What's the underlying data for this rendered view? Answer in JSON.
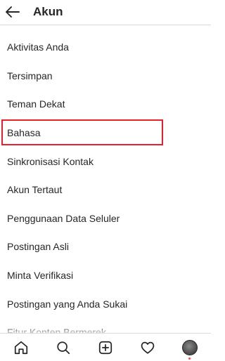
{
  "header": {
    "title": "Akun",
    "back_icon": "arrow-left-icon"
  },
  "menu": {
    "items": [
      {
        "label": "Aktivitas Anda"
      },
      {
        "label": "Tersimpan"
      },
      {
        "label": "Teman Dekat"
      },
      {
        "label": "Bahasa",
        "highlighted": true
      },
      {
        "label": "Sinkronisasi Kontak"
      },
      {
        "label": "Akun Tertaut"
      },
      {
        "label": "Penggunaan Data Seluler"
      },
      {
        "label": "Postingan Asli"
      },
      {
        "label": "Minta Verifikasi"
      },
      {
        "label": "Postingan yang Anda Sukai"
      },
      {
        "label": "Fitur Konten Bermerek"
      }
    ]
  },
  "bottom_nav": {
    "items": [
      {
        "icon": "home-icon"
      },
      {
        "icon": "search-icon"
      },
      {
        "icon": "add-post-icon"
      },
      {
        "icon": "heart-icon"
      },
      {
        "icon": "profile-avatar"
      }
    ]
  },
  "colors": {
    "highlight_border": "#e8202e",
    "text": "#262626",
    "divider": "#dbdbdb",
    "notification_dot": "#ed4956"
  }
}
